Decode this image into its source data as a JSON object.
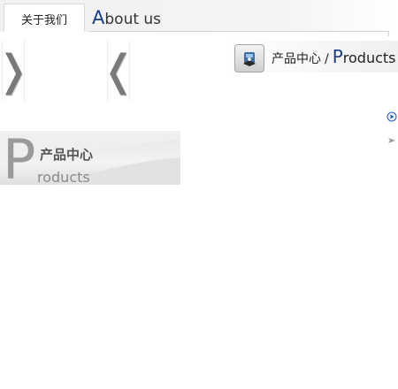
{
  "header": {
    "tab_label": "关于我们",
    "about_cap": "A",
    "about_rest": "bout us"
  },
  "slider": {
    "prev_icon": "chevron-right-icon",
    "next_icon": "chevron-left-icon",
    "prev_glyph": "❭",
    "next_glyph": "❬"
  },
  "breadcrumb": {
    "icon": "product-icon",
    "cn": "产品中心",
    "separator": "/",
    "en_cap": "P",
    "en_rest": "roducts"
  },
  "bullets": [
    {
      "icon": "play-circle-icon",
      "color": "#2a5fb0"
    },
    {
      "icon": "arrow-right-icon",
      "color": "#9a9a9a"
    }
  ],
  "products_panel": {
    "big_letter": "P",
    "title_cn": "产品中心",
    "title_en": "roducts"
  },
  "colors": {
    "accent": "#1a3e8c"
  }
}
